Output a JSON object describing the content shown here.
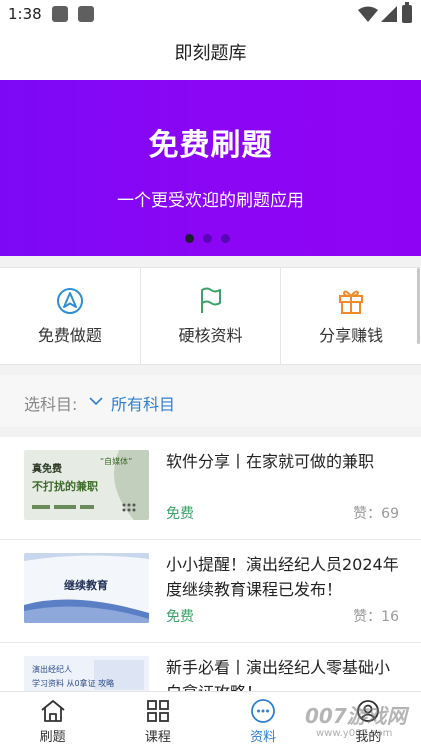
{
  "status_bar": {
    "time": "1:38"
  },
  "header": {
    "title": "即刻题库"
  },
  "banner": {
    "title": "免费刷题",
    "subtitle": "一个更受欢迎的刷题应用",
    "background_color": "#8306f5"
  },
  "features": [
    {
      "label": "免费做题",
      "icon": "navigation-arrow-icon"
    },
    {
      "label": "硬核资料",
      "icon": "flag-icon"
    },
    {
      "label": "分享赚钱",
      "icon": "gift-icon"
    }
  ],
  "filter": {
    "label": "选科目:",
    "value": "所有科目"
  },
  "articles": [
    {
      "title": "软件分享丨在家就可做的兼职",
      "tag": "免费",
      "likes": "赞：69",
      "thumb_texts": [
        "真免费",
        "不打扰的兼职",
        "“自媒体”"
      ]
    },
    {
      "title": "小小提醒！演出经纪人员2024年度继续教育课程已发布！",
      "tag": "免费",
      "likes": "赞：16",
      "thumb_texts": [
        "继续教育"
      ]
    },
    {
      "title": "新手必看丨演出经纪人零基础小白拿证攻略！",
      "tag": "",
      "likes": "",
      "thumb_texts": [
        "演出经纪人",
        "学习资料 从0拿证 攻略"
      ]
    }
  ],
  "tabbar": [
    {
      "label": "刷题",
      "icon": "home-icon",
      "active": false
    },
    {
      "label": "课程",
      "icon": "grid-icon",
      "active": false
    },
    {
      "label": "资料",
      "icon": "chat-bubble-icon",
      "active": true
    },
    {
      "label": "我的",
      "icon": "user-icon",
      "active": false
    }
  ],
  "watermark": {
    "text": "007游戏网",
    "url": "www.y007.com"
  },
  "colors": {
    "accent": "#2f7fd3",
    "free_tag": "#3aa36a",
    "feature_icon": "#2f8fd6",
    "flag_icon": "#3aa36a",
    "gift_icon": "#f08a2a"
  }
}
